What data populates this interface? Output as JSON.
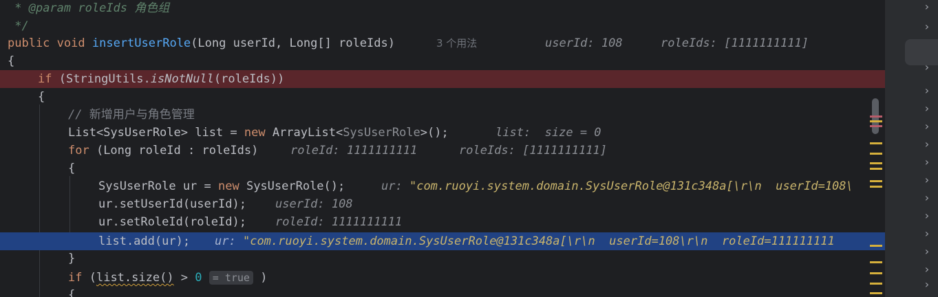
{
  "editor": {
    "lines": {
      "l1": {
        "tag": "@param",
        "text": " roleIds ",
        "cn": "角色组"
      },
      "l2": {
        "text": " */"
      },
      "l3": {
        "kw_public": "public",
        "kw_void": "void",
        "fn": "insertUserRole",
        "params": "(Long userId, Long[] roleIds)",
        "usages": "3 个用法",
        "hint1": "userId: 108",
        "hint2": "roleIds: [1111111111]"
      },
      "l4": {
        "text": "{"
      },
      "l5": {
        "kw": "if",
        "pre": " (StringUtils.",
        "fn": "isNotNull",
        "post": "(roleIds))"
      },
      "l6": {
        "text": "{"
      },
      "l7": {
        "comment": "// ",
        "cn": "新增用户与角色管理"
      },
      "l8": {
        "pre": "List<SysUserRole> list = ",
        "kw": "new",
        "mid": " ArrayList<",
        "type_hint": "SysUserRole",
        "post": ">();",
        "hint": "list:  size = 0"
      },
      "l9": {
        "kw": "for",
        "code": " (Long roleId : roleIds)",
        "hint1": "roleId: 1111111111",
        "hint2": "roleIds: [1111111111]"
      },
      "l10": {
        "text": "{"
      },
      "l11": {
        "pre": "SysUserRole ur = ",
        "kw": "new",
        "post": " SysUserRole();",
        "hint_label": "ur:",
        "hint_val": "\"com.ruoyi.system.domain.SysUserRole@131c348a[\\r\\n  userId=108\\"
      },
      "l12": {
        "code": "ur.setUserId(userId);",
        "hint": "userId: 108"
      },
      "l13": {
        "code": "ur.setRoleId(roleId);",
        "hint": "roleId: 1111111111"
      },
      "l14": {
        "code": "list.add(ur);",
        "hint_label": "ur:",
        "hint_val": "\"com.ruoyi.system.domain.SysUserRole@131c348a[\\r\\n  userId=108\\r\\n  roleId=111111111"
      },
      "l15": {
        "text": "}"
      },
      "l16": {
        "kw": "if",
        "pre": " (",
        "squig": "list.size()",
        "mid": " > ",
        "num": "0",
        "inlay": "= true",
        "post": " )"
      },
      "l17": {
        "text": "{"
      }
    }
  },
  "colors": {
    "background": "#1e1f22",
    "keyword": "#cf8e6d",
    "function": "#56a8f5",
    "breakpoint_line": "#5a262b",
    "execution_line": "#214283"
  }
}
